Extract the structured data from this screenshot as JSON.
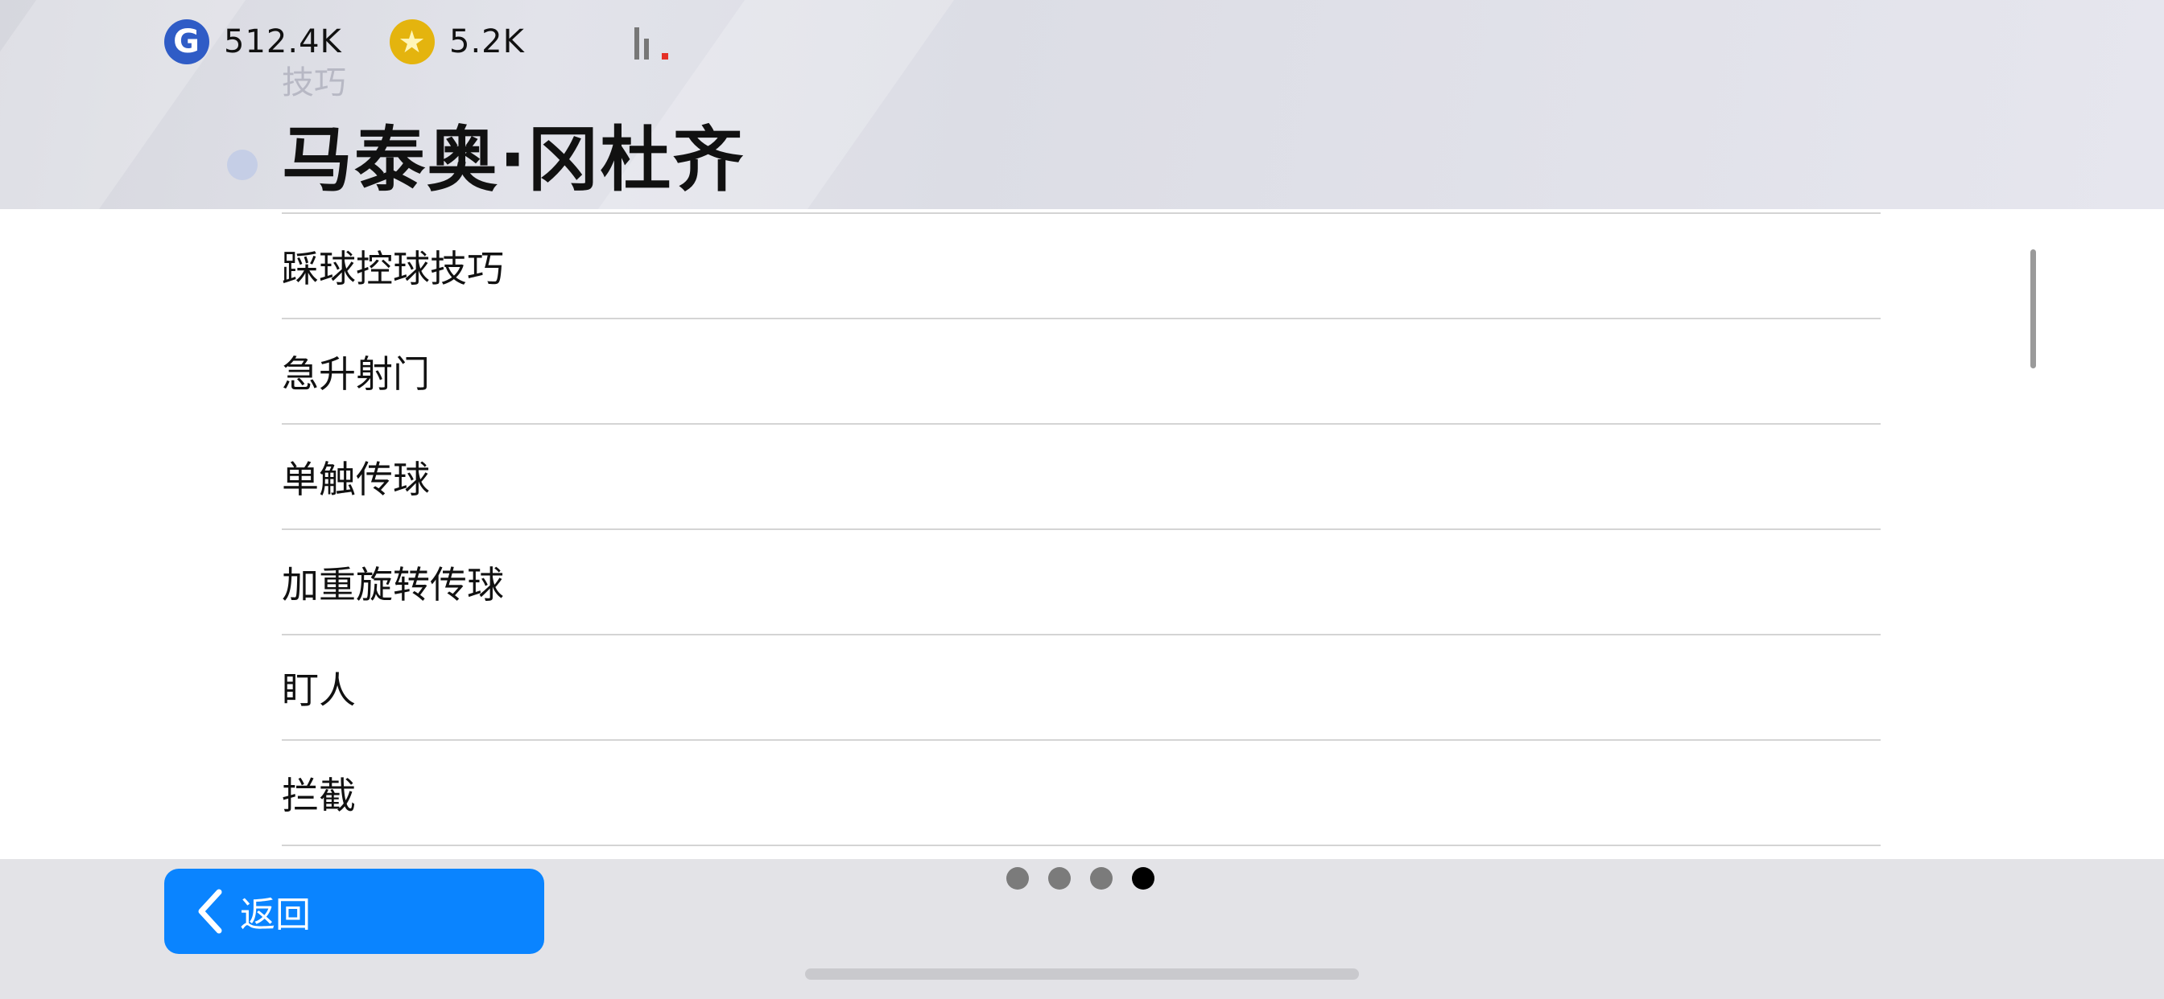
{
  "header": {
    "currencies": [
      {
        "icon": "g-coin-icon",
        "symbol": "G",
        "value": "512.4K"
      },
      {
        "icon": "star-coin-icon",
        "symbol": "★",
        "value": "5.2K"
      }
    ],
    "ghost_label": "技巧",
    "player_name": "马泰奥·冈杜齐"
  },
  "skills": [
    "踩球控球技巧",
    "急升射门",
    "单触传球",
    "加重旋转传球",
    "盯人",
    "拦截"
  ],
  "footer": {
    "back_label": "返回",
    "pages_total": 4,
    "page_active": 4
  },
  "colors": {
    "accent": "#0a84ff",
    "coin_g": "#2f5cc6",
    "coin_star": "#e4b40e",
    "signal_alert": "#e53026"
  }
}
